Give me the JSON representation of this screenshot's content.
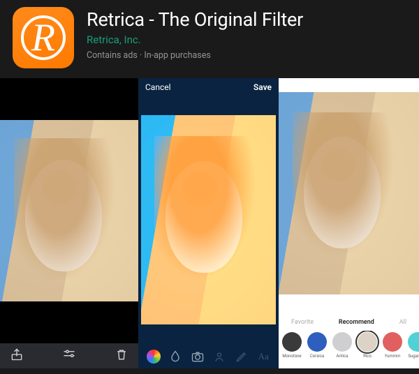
{
  "header": {
    "title": "Retrica - The Original Filter",
    "developer": "Retrica, Inc.",
    "meta": "Contains ads · In-app purchases"
  },
  "shot1": {
    "icons": {
      "share": "share-icon",
      "sliders": "sliders-icon",
      "trash": "trash-icon"
    }
  },
  "shot2": {
    "cancel": "Cancel",
    "save": "Save",
    "tools": {
      "palette": "palette-icon",
      "drop": "drop-icon",
      "camera": "camera-icon",
      "person": "person-icon",
      "pencil": "pencil-icon",
      "text": "text-icon"
    }
  },
  "shot3": {
    "tabs": {
      "left": "Favorite",
      "center": "Recommend",
      "right": "All"
    },
    "filters": [
      {
        "name": "Monotone",
        "color": "#3a3a3a"
      },
      {
        "name": "Corsica",
        "color": "#2e5fbf"
      },
      {
        "name": "Antica",
        "color": "#cfcfd2"
      },
      {
        "name": "Rico",
        "color": "#ddd2c6"
      },
      {
        "name": "Yummm",
        "color": "#e06060"
      },
      {
        "name": "Sugarrush",
        "color": "#4fd2d6"
      }
    ]
  }
}
